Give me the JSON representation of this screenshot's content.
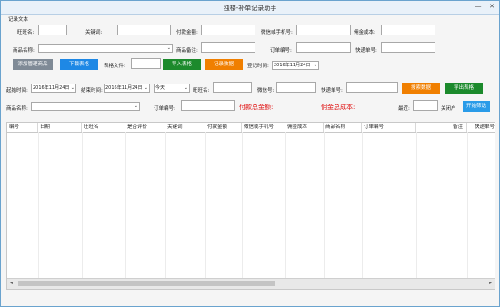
{
  "window": {
    "title": "独楼-补单记录助手",
    "minimize": "—",
    "close": "✕"
  },
  "record": {
    "group_label": "记录文本",
    "wangwang_label": "旺旺名:",
    "keyword_label": "关键词:",
    "payment_label": "付款金额:",
    "wechat_label": "微信或手机号:",
    "commission_label": "佣金成本:",
    "product_label": "商品名称:",
    "product_note_label": "商品备注:",
    "order_no_label": "订单编号:",
    "express_label": "快递单号:",
    "add_product_btn": "添加管理商品",
    "download_template_btn": "下载表格",
    "table_file_label": "表格文件:",
    "import_btn": "导入表格",
    "record_btn": "记录数据",
    "reg_time_label": "登记时间:",
    "reg_time_value": "2016年11月24日"
  },
  "filter": {
    "start_label": "起始时间:",
    "start_value": "2016年11月24日",
    "end_label": "结束时间:",
    "end_value": "2016年11月24日",
    "range_value": "今天",
    "wangwang_label": "旺旺名:",
    "wechat_label": "微信号:",
    "express_label": "快递单号:",
    "search_btn": "搜索数据",
    "export_btn": "导出表格",
    "product_label": "商品名称:",
    "order_label": "订单编号:",
    "total_pay_label": "付款总金额:",
    "total_comm_label": "佣金总成本:",
    "count_label": "最近:",
    "close_user_label": "关闭户",
    "start_filter_btn": "开始筛选"
  },
  "table": {
    "columns": [
      "编号",
      "日期",
      "旺旺名",
      "是否评价",
      "关键词",
      "付款金额",
      "微信或手机号",
      "佣金成本",
      "商品名称",
      "订单编号",
      "备注",
      "快递单号"
    ],
    "rows": []
  }
}
